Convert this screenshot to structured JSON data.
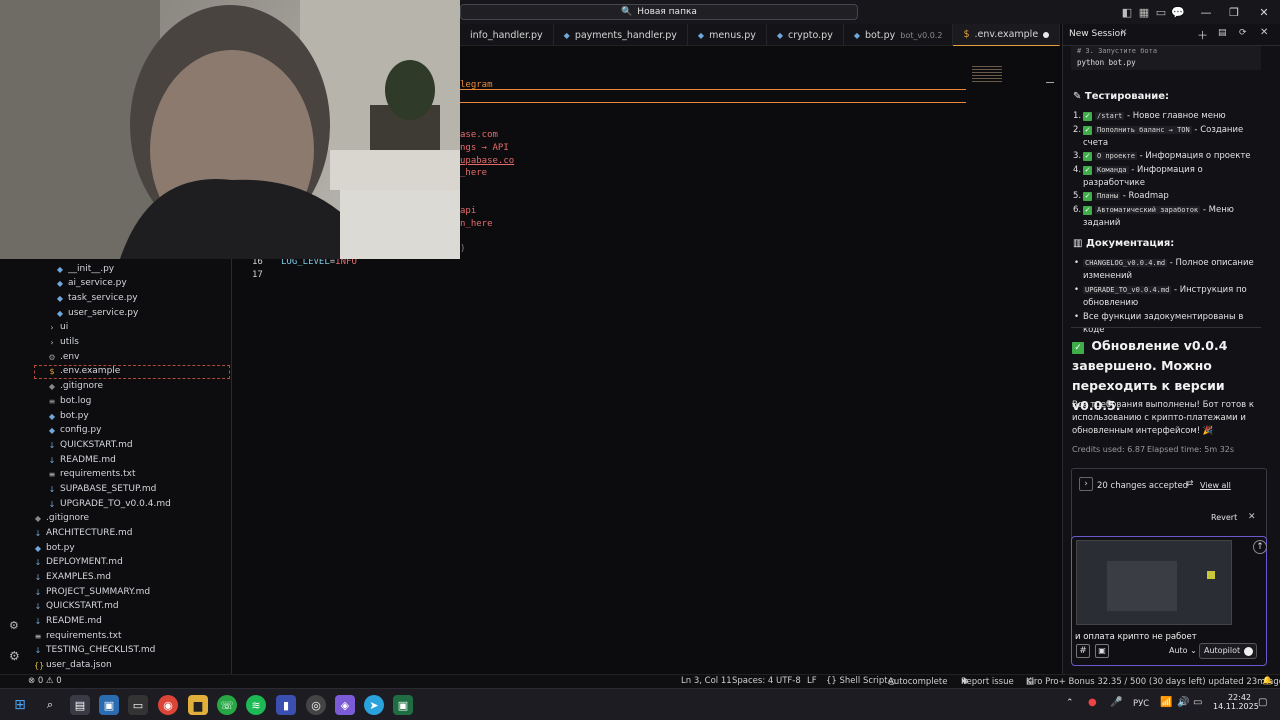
{
  "titlebar": {
    "command_center": "Новая папка"
  },
  "tabs": [
    {
      "label": "info_handler.py",
      "sub": ""
    },
    {
      "label": "payments_handler.py",
      "sub": ""
    },
    {
      "label": "menus.py",
      "sub": ""
    },
    {
      "label": "crypto.py",
      "sub": ""
    },
    {
      "label": "bot.py",
      "sub": "bot_v0.0.2"
    },
    {
      "label": ".env.example",
      "sub": ""
    }
  ],
  "editor": {
    "frag1": "legram",
    "frag2": "ase.com",
    "frag3": "ngs → API",
    "frag4": "upabase.co",
    "frag5": "_here",
    "frag6": "api",
    "frag7": "n_here",
    "frag8": ")",
    "line16_num": "16",
    "line16_code_key": "LOG_LEVEL",
    "line16_code_eq": "=",
    "line16_code_val": "INFO",
    "line17_num": "17"
  },
  "explorer": {
    "items": [
      {
        "label": "__init__.py",
        "icon": "python-icon"
      },
      {
        "label": "ai_service.py",
        "icon": "python-icon"
      },
      {
        "label": "task_service.py",
        "icon": "python-icon"
      },
      {
        "label": "user_service.py",
        "icon": "python-icon"
      },
      {
        "label": "ui",
        "icon": "chevron-right-icon"
      },
      {
        "label": "utils",
        "icon": "chevron-right-icon"
      },
      {
        "label": ".env",
        "icon": "gear-icon"
      },
      {
        "label": ".env.example",
        "icon": "dollar-icon"
      },
      {
        "label": ".gitignore",
        "icon": "git-icon"
      },
      {
        "label": "bot.log",
        "icon": "log-icon"
      },
      {
        "label": "bot.py",
        "icon": "python-icon"
      },
      {
        "label": "config.py",
        "icon": "python-icon"
      },
      {
        "label": "QUICKSTART.md",
        "icon": "markdown-icon"
      },
      {
        "label": "README.md",
        "icon": "markdown-icon"
      },
      {
        "label": "requirements.txt",
        "icon": "text-icon"
      },
      {
        "label": "SUPABASE_SETUP.md",
        "icon": "markdown-icon"
      },
      {
        "label": "UPGRADE_TO_v0.0.4.md",
        "icon": "markdown-icon"
      },
      {
        "label": ".gitignore",
        "icon": "git-icon"
      },
      {
        "label": "ARCHITECTURE.md",
        "icon": "markdown-icon"
      },
      {
        "label": "bot.py",
        "icon": "python-icon"
      },
      {
        "label": "DEPLOYMENT.md",
        "icon": "markdown-icon"
      },
      {
        "label": "EXAMPLES.md",
        "icon": "markdown-icon"
      },
      {
        "label": "PROJECT_SUMMARY.md",
        "icon": "markdown-icon"
      },
      {
        "label": "QUICKSTART.md",
        "icon": "markdown-icon"
      },
      {
        "label": "README.md",
        "icon": "markdown-icon"
      },
      {
        "label": "requirements.txt",
        "icon": "text-icon"
      },
      {
        "label": "TESTING_CHECKLIST.md",
        "icon": "markdown-icon"
      },
      {
        "label": "user_data.json",
        "icon": "json-icon"
      }
    ]
  },
  "panel": {
    "session_title": "New Session",
    "code_comment": "# 3. Запустите бота",
    "code_cmd": "python bot.py",
    "testing_heading": "Тестирование:",
    "tests": [
      {
        "code": "/start",
        "text": " - Новое главное меню"
      },
      {
        "code": "Пополнить баланс → TON",
        "text": " - Создание счета"
      },
      {
        "code": "О проекте",
        "text": " - Информация о проекте"
      },
      {
        "code": "Команда",
        "text": " - Информация о разработчике"
      },
      {
        "code": "Планы",
        "text": " - Roadmap"
      },
      {
        "code": "Автоматический заработок",
        "text": " - Меню заданий"
      }
    ],
    "docs_heading": "Документация:",
    "docs": [
      {
        "code": "CHANGELOG_v0.0.4.md",
        "text": " - Полное описание изменений"
      },
      {
        "code": "UPGRADE_TO_v0.0.4.md",
        "text": " - Инструкция по обновлению"
      },
      {
        "code": "",
        "text": "Все функции задокументированы в коде"
      }
    ],
    "big_heading": "Обновление v0.0.4 завершено. Можно переходить к версии v0.0.5.",
    "summary": "Все требования выполнены! Бот готов к использованию с крипто-платежами и обновленным интерфейсом! 🎉",
    "credits": "Credits used: 6.87",
    "elapsed": "Elapsed time: 5m 32s",
    "changes": "20 changes accepted",
    "view_all": "View all",
    "revert": "Revert",
    "input_text": "и оплата крипто не рабоет",
    "mode": "Auto",
    "autopilot": "Autopilot"
  },
  "status": {
    "problems": "⊗ 0 ⚠ 0",
    "position": "Ln 3, Col 11",
    "spaces": "Spaces: 4",
    "encoding": "UTF-8",
    "eol": "LF",
    "language": "{} Shell Script",
    "autocomplete": "Autocomplete",
    "report": "Report issue",
    "plan": "Kiro Pro+ Bonus 32.35 / 500 (30 days left) updated 23m ago"
  },
  "taskbar": {
    "lang": "РУС",
    "time": "22:42",
    "date": "14.11.2025"
  }
}
